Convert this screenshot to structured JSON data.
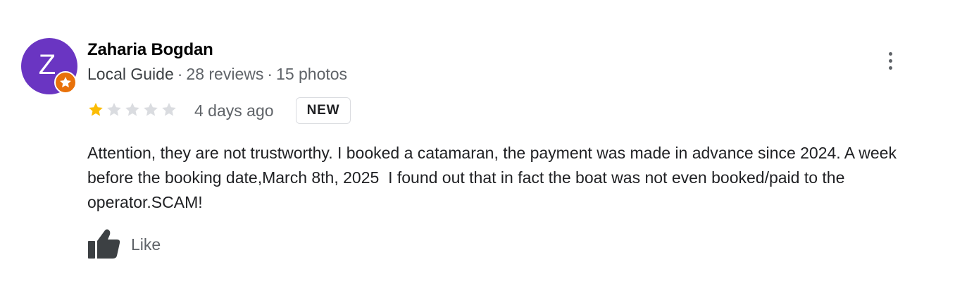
{
  "review": {
    "author": {
      "initial": "Z",
      "name": "Zaharia Bogdan",
      "badge": "Local Guide",
      "reviews": "28 reviews",
      "photos": "15 photos",
      "avatar_color": "#6a35c2",
      "badge_color": "#e8710a"
    },
    "rating": {
      "stars": 1,
      "max_stars": 5,
      "filled_color": "#fbbc04",
      "empty_color": "#dadce0"
    },
    "date": "4 days ago",
    "new_badge": "NEW",
    "text": "Attention, they are not trustworthy. I booked a catamaran, the payment was made in advance since 2024. A week before the booking date,March 8th, 2025  I found out that in fact the boat was not even booked/paid to the operator.SCAM!",
    "actions": {
      "like_label": "Like"
    },
    "menu_icon": "more-vert-icon"
  }
}
